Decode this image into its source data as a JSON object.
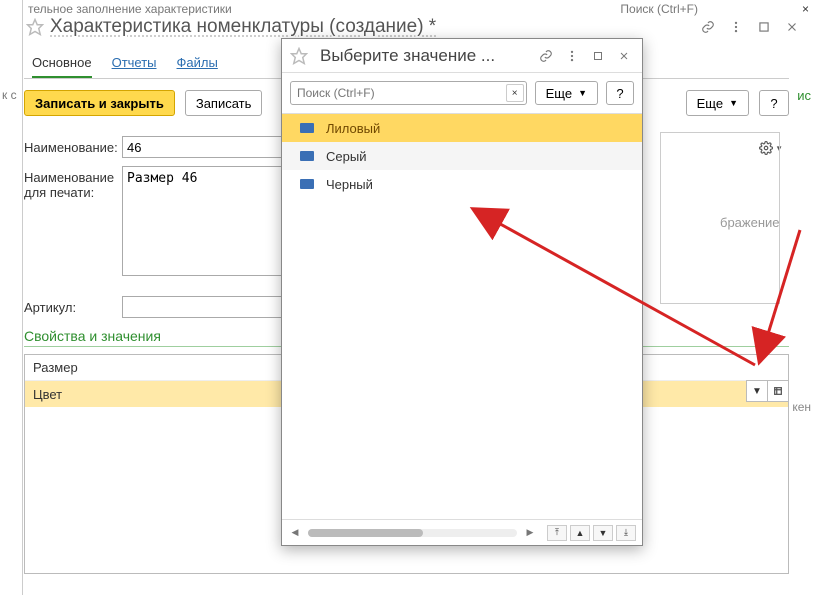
{
  "fragments": {
    "top1": "тельное заполнение характеристики",
    "top2": "к с",
    "search_hint": "Поиск (Ctrl+F)",
    "green_right": "ис",
    "gray_bottom": "кен"
  },
  "main": {
    "title": "Характеристика номенклатуры (создание) *",
    "tabs": {
      "main": "Основное",
      "reports": "Отчеты",
      "files": "Файлы"
    },
    "buttons": {
      "save_close": "Записать и закрыть",
      "save": "Записать",
      "more": "Еще"
    },
    "fields": {
      "name_label": "Наименование:",
      "name_value": "46",
      "print_label": "Наименование для печати:",
      "print_value": "Размер 46",
      "sku_label": "Артикул:",
      "sku_value": ""
    },
    "section": "Свойства и значения",
    "properties": {
      "rows": [
        "Размер",
        "Цвет"
      ]
    },
    "image_placeholder": "бражение"
  },
  "popup": {
    "title": "Выберите значение ...",
    "search_placeholder": "Поиск (Ctrl+F)",
    "more": "Еще",
    "items": [
      "Лиловый",
      "Серый",
      "Черный"
    ]
  }
}
